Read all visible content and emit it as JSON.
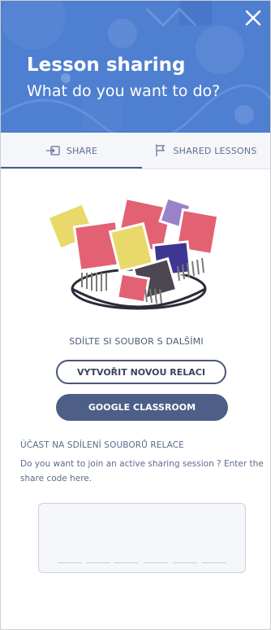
{
  "header": {
    "title": "Lesson sharing",
    "subtitle": "What do you want to do?",
    "close_icon": "close-icon"
  },
  "tabs": [
    {
      "label": "SHARE",
      "icon": "share-arrow-icon",
      "active": true
    },
    {
      "label": "SHARED LESSONS",
      "icon": "flag-icon",
      "active": false
    }
  ],
  "illustration": {
    "icon": "papers-bowl-illustration"
  },
  "share": {
    "caption": "SDÍLTE SI SOUBOR S DALŠÍMI",
    "new_session_label": "VYTVOŘIT NOVOU RELACI",
    "google_label": "GOOGLE CLASSROOM"
  },
  "join": {
    "heading": "ÚČAST NA SDÍLENÍ SOUBORŮ RELACE",
    "text": "Do you want to join an active sharing session ? Enter the share code here.",
    "code_value": ""
  },
  "colors": {
    "header": "#4f7fd1",
    "accent": "#4d5f86",
    "tab_bg": "#f4f6f9"
  }
}
